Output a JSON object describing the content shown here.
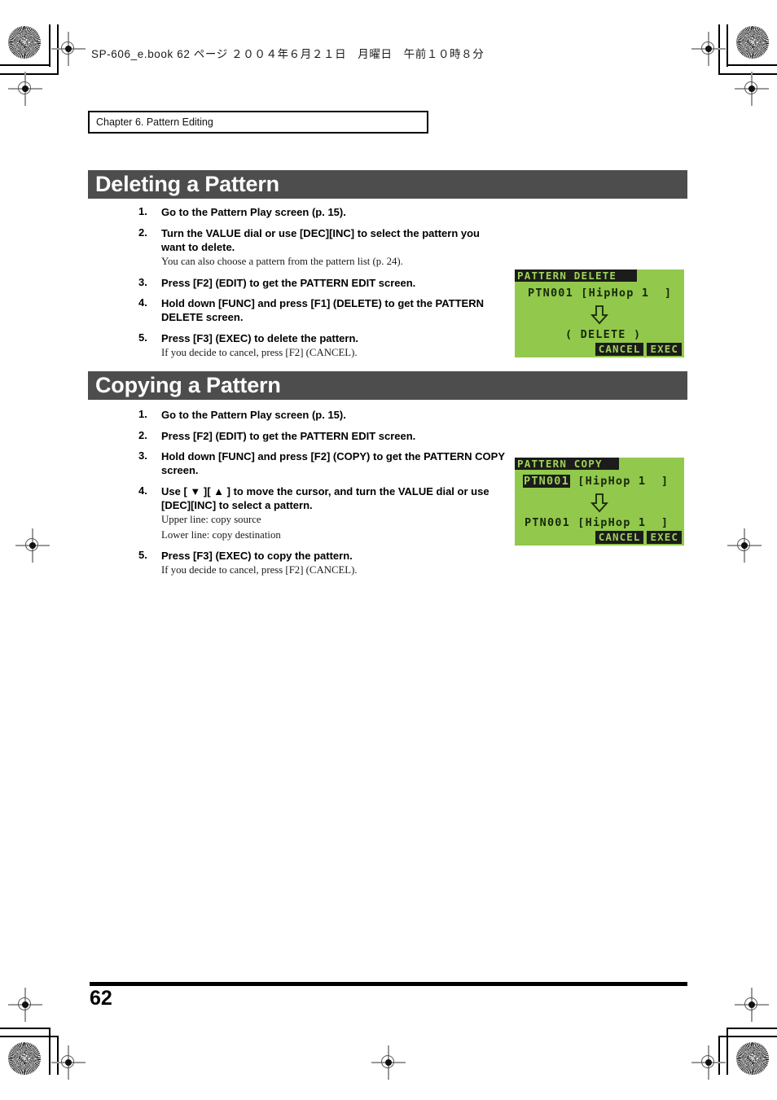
{
  "book_header": "SP-606_e.book 62 ページ ２００４年６月２１日　月曜日　午前１０時８分",
  "chapter": "Chapter 6. Pattern Editing",
  "page_number": "62",
  "colors": {
    "heading_bar": "#4d4d4d",
    "lcd_background": "#92c84c",
    "lcd_foreground": "#18290a",
    "lcd_inverted_bg": "#1c1c1c",
    "lcd_inverted_fg": "#9ed456"
  },
  "sections": [
    {
      "title": "Deleting a Pattern",
      "steps": [
        {
          "num": "1.",
          "title": "Go to the Pattern Play screen (p. 15).",
          "notes": []
        },
        {
          "num": "2.",
          "title": "Turn the VALUE dial or use [DEC][INC] to select the pattern you want to delete.",
          "notes": [
            "You can also choose a pattern from the pattern list (p. 24)."
          ]
        },
        {
          "num": "3.",
          "title": "Press [F2] (EDIT) to get the PATTERN EDIT screen.",
          "notes": []
        },
        {
          "num": "4.",
          "title": "Hold down [FUNC] and press [F1] (DELETE) to get the PATTERN DELETE screen.",
          "notes": []
        },
        {
          "num": "5.",
          "title": "Press [F3] (EXEC) to delete the pattern.",
          "notes": [
            "If you decide to cancel, press [F2] (CANCEL)."
          ]
        }
      ],
      "lcd": {
        "title": "PATTERN DELETE",
        "line1": "PTN001 [HipHop 1  ]",
        "line1_highlight": false,
        "arrow": "down-arrow",
        "line2": "( DELETE )",
        "line2_highlight": false,
        "softkeys": [
          "CANCEL",
          "EXEC"
        ]
      }
    },
    {
      "title": "Copying a Pattern",
      "steps": [
        {
          "num": "1.",
          "title": "Go to the Pattern Play screen (p. 15).",
          "notes": []
        },
        {
          "num": "2.",
          "title": "Press [F2] (EDIT) to get the PATTERN EDIT screen.",
          "notes": []
        },
        {
          "num": "3.",
          "title": "Hold down [FUNC] and press [F2] (COPY) to get the PATTERN COPY screen.",
          "notes": []
        },
        {
          "num": "4.",
          "title": "Use [ ▼ ][ ▲ ] to move the cursor, and turn the VALUE dial or use [DEC][INC] to select a pattern.",
          "notes": [
            "Upper line: copy source",
            "Lower line: copy destination"
          ]
        },
        {
          "num": "5.",
          "title": "Press [F3] (EXEC) to copy the pattern.",
          "notes": [
            "If you decide to cancel, press [F2] (CANCEL)."
          ]
        }
      ],
      "lcd": {
        "title": "PATTERN COPY",
        "line1_highlighted_text": "PTN001",
        "line1_rest": " [HipHop 1  ]",
        "line1_highlight": true,
        "arrow": "down-arrow",
        "line2": "PTN001 [HipHop 1  ]",
        "line2_highlight": false,
        "softkeys": [
          "CANCEL",
          "EXEC"
        ]
      }
    }
  ]
}
